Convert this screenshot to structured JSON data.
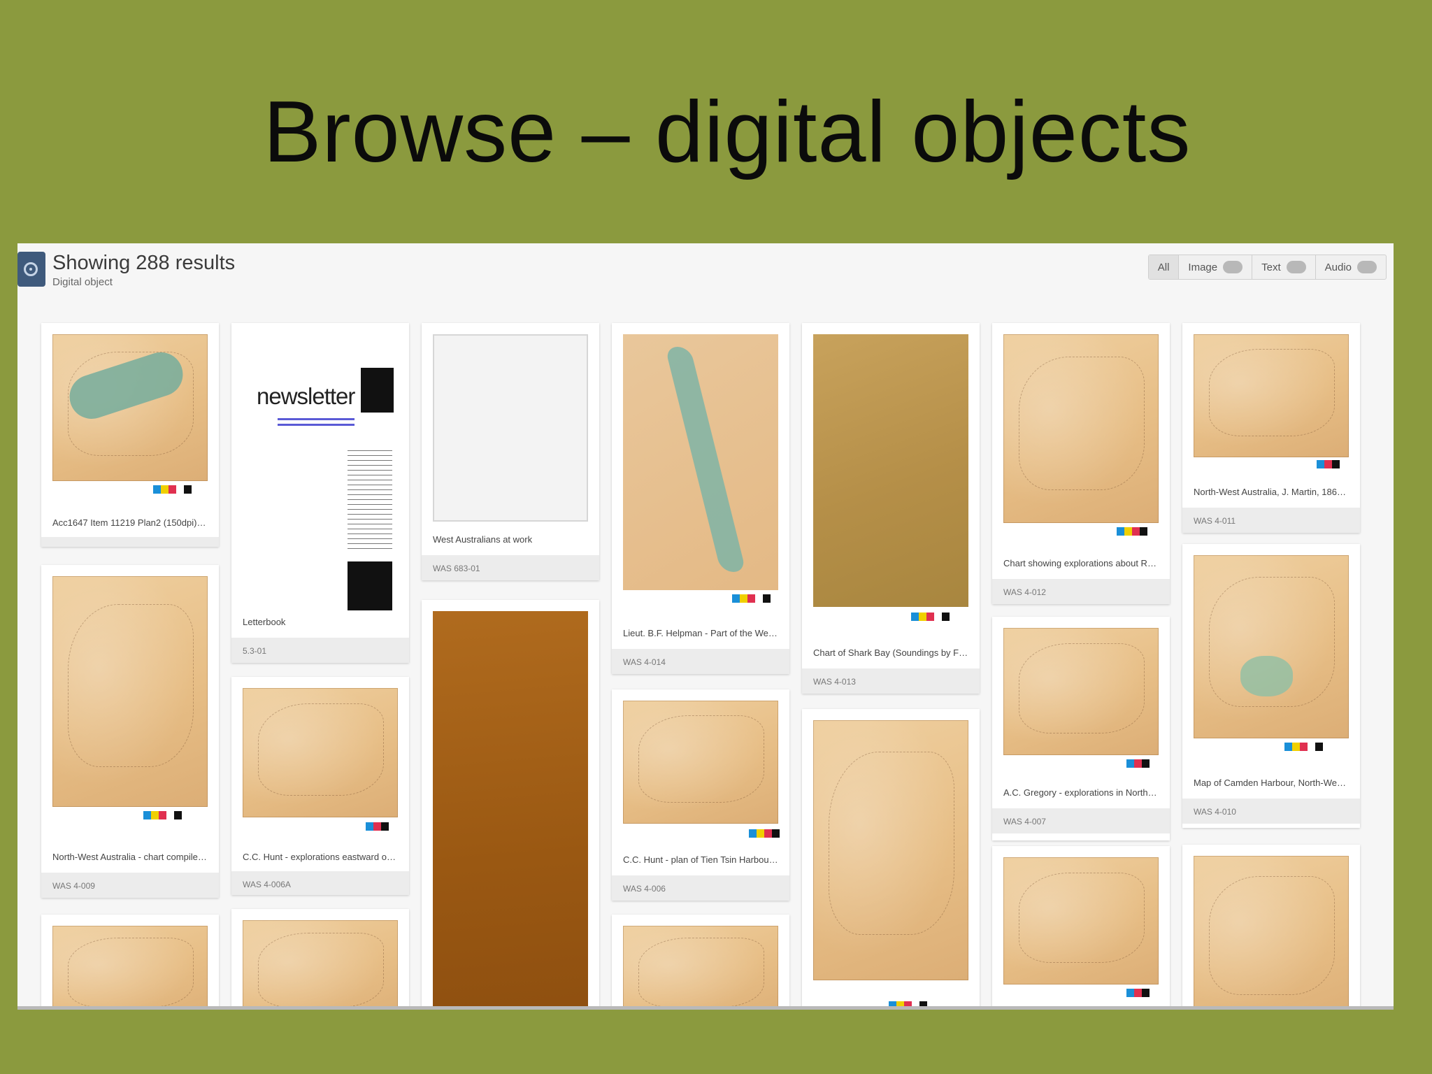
{
  "slide": {
    "title": "Browse – digital objects"
  },
  "header": {
    "results_title": "Showing 288 results",
    "subtitle": "Digital object",
    "filters": [
      {
        "label": "All",
        "count": "",
        "active": true
      },
      {
        "label": "Image",
        "count": "",
        "active": false
      },
      {
        "label": "Text",
        "count": "",
        "active": false
      },
      {
        "label": "Audio",
        "count": "",
        "active": false
      }
    ]
  },
  "cards": [
    {
      "title": "Acc1647 Item 11219 Plan2 (150dpi).jpg",
      "id": ""
    },
    {
      "title": "Letterbook",
      "id": "5.3-01"
    },
    {
      "title": "West Australians at work",
      "id": "WAS 683-01"
    },
    {
      "title": "Lieut. B.F. Helpman - Part of the West C...",
      "id": "WAS 4-014"
    },
    {
      "title": "Chart of Shark Bay (Soundings by Freyci...",
      "id": "WAS 4-013"
    },
    {
      "title": "Chart showing explorations about Roeb...",
      "id": "WAS 4-012"
    },
    {
      "title": "North-West Australia, J. Martin, 1864. (4...",
      "id": "WAS 4-011"
    },
    {
      "title": "North-West Australia - chart compiled f...",
      "id": "WAS 4-009"
    },
    {
      "title": "C.C. Hunt - explorations eastward of N...",
      "id": "WAS 4-006A"
    },
    {
      "title": "C.C. Hunt - plan of Tien Tsin Harbour (P...",
      "id": "WAS 4-006"
    },
    {
      "title": "A.C. Gregory - explorations in Northern ...",
      "id": "WAS 4-007"
    },
    {
      "title": "Map of Camden Harbour, North-West A...",
      "id": "WAS 4-010"
    }
  ],
  "newsletter": {
    "word": "newsletter"
  },
  "colors": {
    "slide_bg": "#8b9a3e",
    "page_bg": "#f6f6f6",
    "icon_blue": "#3f5a7c"
  }
}
